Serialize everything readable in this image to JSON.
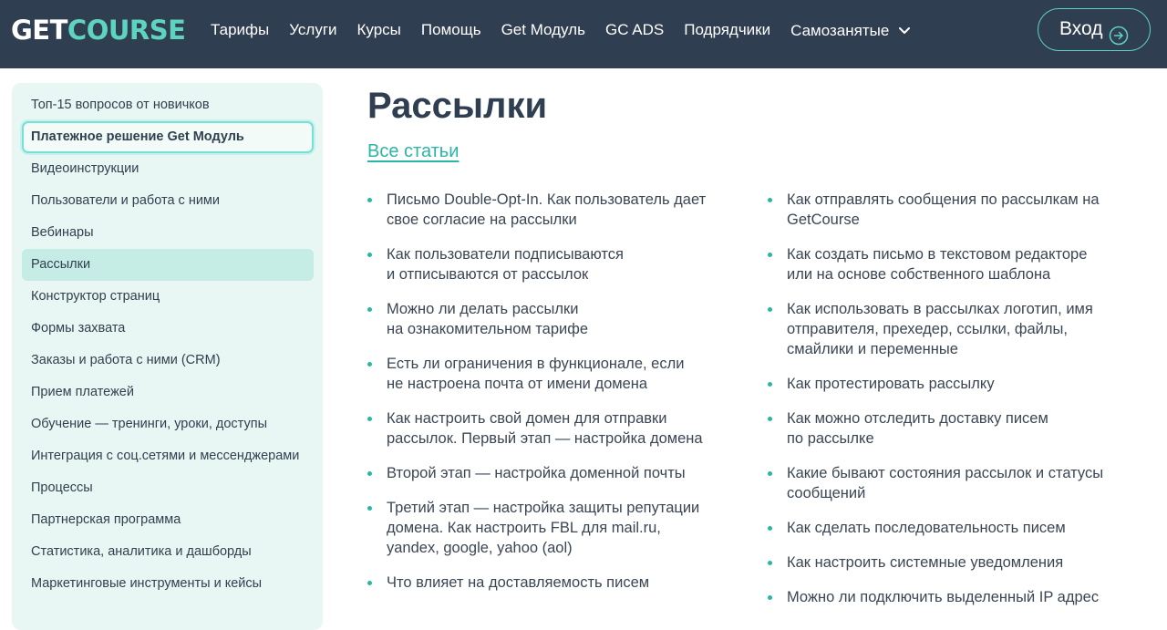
{
  "header": {
    "logo_get": "GET",
    "logo_course": "COURSE",
    "nav": [
      {
        "label": "Тарифы"
      },
      {
        "label": "Услуги"
      },
      {
        "label": "Курсы"
      },
      {
        "label": "Помощь"
      },
      {
        "label": "Get Модуль"
      },
      {
        "label": "GC ADS"
      },
      {
        "label": "Подрядчики"
      },
      {
        "label": "Самозанятые"
      }
    ],
    "login_label": "Вход"
  },
  "sidebar": {
    "items": [
      {
        "label": "Топ-15 вопросов от новичков"
      },
      {
        "label": "Платежное решение Get Модуль"
      },
      {
        "label": "Видеоинструкции"
      },
      {
        "label": "Пользователи и работа с ними"
      },
      {
        "label": "Вебинары"
      },
      {
        "label": "Рассылки"
      },
      {
        "label": "Конструктор страниц"
      },
      {
        "label": "Формы захвата"
      },
      {
        "label": "Заказы и работа с ними (CRM)"
      },
      {
        "label": "Прием платежей"
      },
      {
        "label": "Обучение — тренинги, уроки, доступы"
      },
      {
        "label": "Интеграция с соц.сетями и мессенджерами"
      },
      {
        "label": "Процессы"
      },
      {
        "label": "Партнерская программа"
      },
      {
        "label": "Статистика, аналитика и дашборды"
      },
      {
        "label": "Маркетинговые инструменты и кейсы"
      }
    ]
  },
  "main": {
    "title": "Рассылки",
    "all_articles": "Все статьи",
    "left_articles": [
      {
        "lines": [
          "Письмо Double-Opt-In. Как пользователь дает",
          "свое согласие на рассылки"
        ]
      },
      {
        "lines": [
          "Как пользователи подписываются",
          "и отписываются от рассылок"
        ]
      },
      {
        "lines": [
          "Можно ли делать рассылки",
          "на ознакомительном тарифе"
        ]
      },
      {
        "lines": [
          "Есть ли ограничения в функционале, если",
          "не настроена почта от имени домена"
        ]
      },
      {
        "lines": [
          "Как настроить свой домен для отправки",
          "рассылок. Первый этап — настройка домена"
        ]
      },
      {
        "lines": [
          "Второй этап — настройка доменной почты"
        ]
      },
      {
        "lines": [
          "Третий этап — настройка защиты репутации",
          "домена. Как настроить FBL для mail.ru,",
          "yandex, google, yahoo (aol)"
        ]
      },
      {
        "lines": [
          "Что влияет на доставляемость писем"
        ]
      }
    ],
    "right_articles": [
      {
        "lines": [
          "Как отправлять сообщения по рассылкам на",
          "GetCourse"
        ]
      },
      {
        "lines": [
          "Как создать письмо в текстовом редакторе",
          "или на основе собственного шаблона"
        ]
      },
      {
        "lines": [
          "Как использовать в рассылках логотип, имя",
          "отправителя, прехедер, ссылки, файлы,",
          "смайлики и переменные"
        ]
      },
      {
        "lines": [
          "Как протестировать рассылку"
        ]
      },
      {
        "lines": [
          "Как можно отследить доставку писем",
          "по рассылке"
        ]
      },
      {
        "lines": [
          "Какие бывают состояния рассылок и статусы",
          "сообщений"
        ]
      },
      {
        "lines": [
          "Как сделать последовательность писем"
        ]
      },
      {
        "lines": [
          "Как настроить системные уведомления"
        ]
      },
      {
        "lines": [
          "Можно ли подключить выделенный IP адрес"
        ]
      }
    ]
  },
  "colors": {
    "header_bg": "#2f3e50",
    "accent": "#5fd3c2",
    "link": "#2ab5a5",
    "sidebar_bg": "#e9f7f4",
    "sidebar_active": "#c6ece6"
  }
}
